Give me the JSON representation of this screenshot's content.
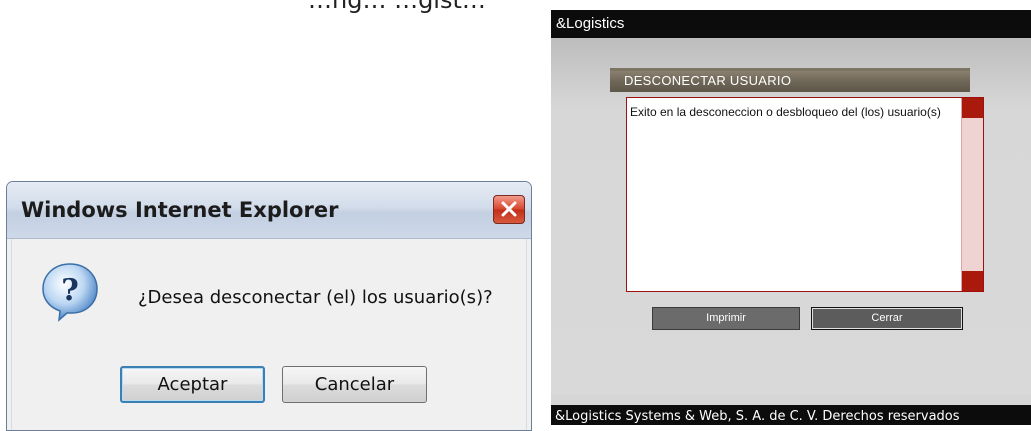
{
  "top_heading": "…ng… …gist…",
  "ie_dialog": {
    "title": "Windows Internet Explorer",
    "message": "¿Desea desconectar (el) los usuario(s)?",
    "ok_label": "Aceptar",
    "cancel_label": "Cancelar",
    "icon": "question-icon"
  },
  "logistics": {
    "brand": "&Logistics",
    "panel_title": "DESCONECTAR USUARIO",
    "message": "Exito en la desconeccion o desbloqueo del (los) usuario(s)",
    "print_label": "Imprimir",
    "close_label": "Cerrar",
    "footer": "&Logistics  Systems & Web,  S. A. de C. V.   Derechos reservados"
  },
  "colors": {
    "logistics_header": "#0c0c0c",
    "panel_header": "#6e6657",
    "textbox_border": "#a01010",
    "scroll_arrow": "#aa1a0c",
    "ie_close": "#c0301a"
  }
}
